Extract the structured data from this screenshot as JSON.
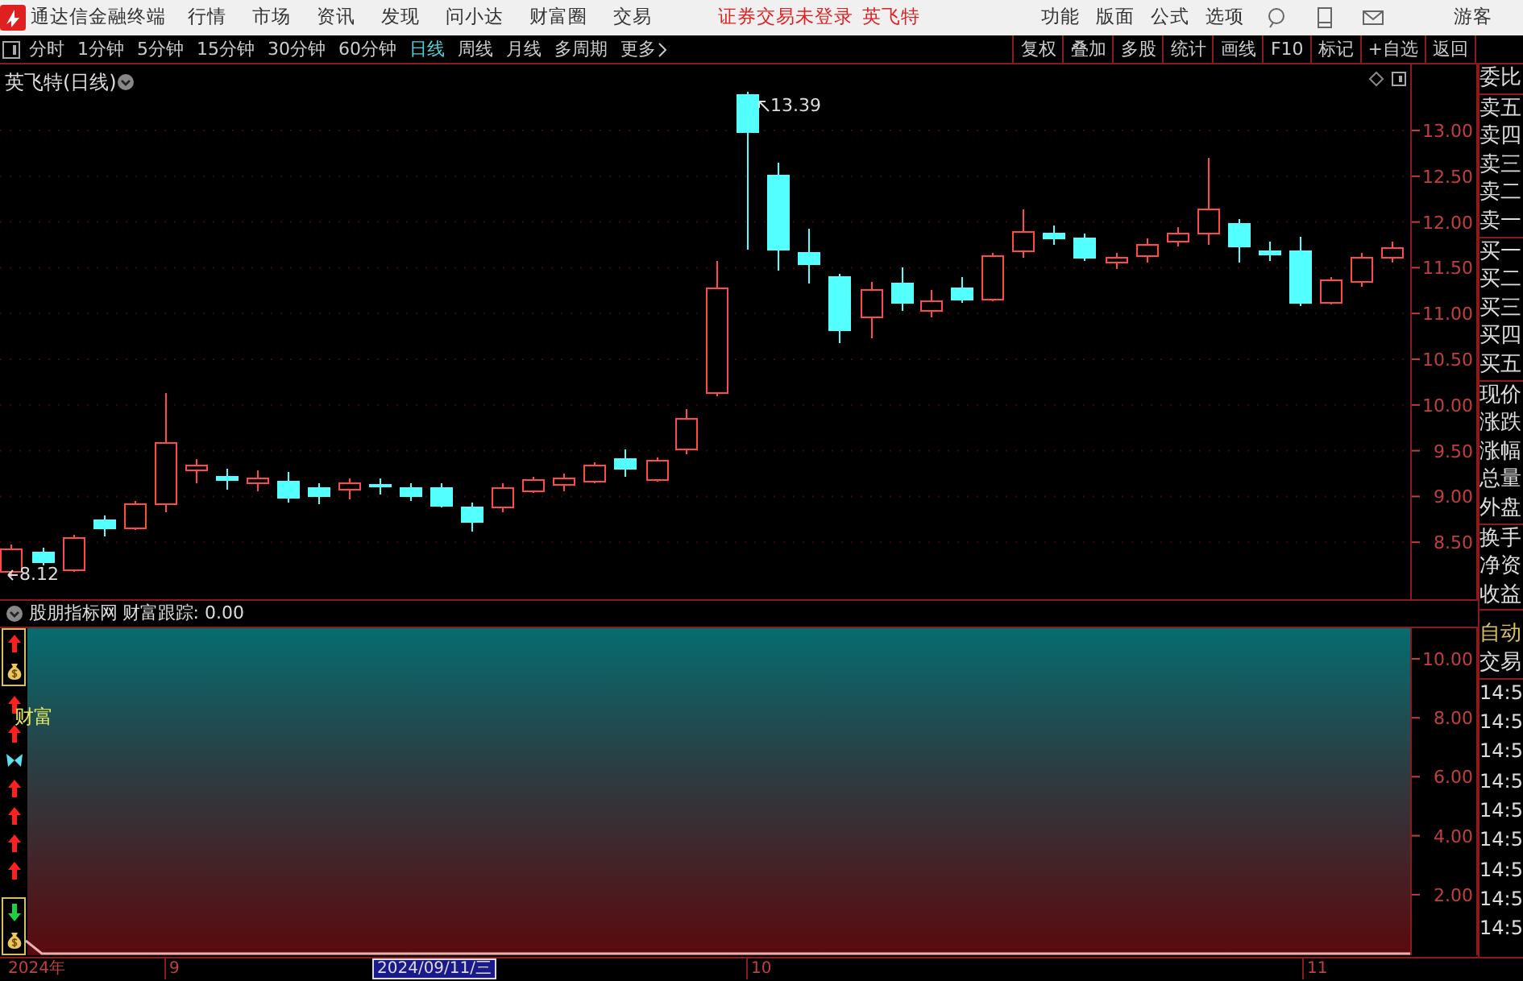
{
  "title_bar": {
    "app_title": "通达信金融终端",
    "menus": [
      "行情",
      "市场",
      "资讯",
      "发现",
      "问小达",
      "财富圈",
      "交易"
    ],
    "notice": "证券交易未登录",
    "stock": "英飞特",
    "tools": [
      "功能",
      "版面",
      "公式",
      "选项"
    ],
    "user": "游客"
  },
  "period_bar": {
    "periods": [
      {
        "label": "分时",
        "selected": false
      },
      {
        "label": "1分钟",
        "selected": false
      },
      {
        "label": "5分钟",
        "selected": false
      },
      {
        "label": "15分钟",
        "selected": false
      },
      {
        "label": "30分钟",
        "selected": false
      },
      {
        "label": "60分钟",
        "selected": false
      },
      {
        "label": "日线",
        "selected": true
      },
      {
        "label": "周线",
        "selected": false
      },
      {
        "label": "月线",
        "selected": false
      },
      {
        "label": "多周期",
        "selected": false
      }
    ],
    "more": "更多",
    "actions": [
      "复权",
      "叠加",
      "多股",
      "统计",
      "画线",
      "F10",
      "标记",
      "+自选",
      "返回"
    ]
  },
  "main_chart": {
    "caption": "英飞特(日线)",
    "high_label": "13.39",
    "low_label": "8.12",
    "yticks": [
      "13.00",
      "12.50",
      "12.00",
      "11.50",
      "11.00",
      "10.50",
      "10.00",
      "9.50",
      "9.00",
      "8.50"
    ]
  },
  "indicator": {
    "source": "股朋指标网",
    "reading": "财富跟踪: 0.00",
    "signal_text": "财富",
    "yticks": [
      "10.00",
      "8.00",
      "6.00",
      "4.00",
      "2.00"
    ]
  },
  "quote_panel": {
    "groups": [
      [
        "委比"
      ],
      [
        "卖五",
        "卖四",
        "卖三",
        "卖二",
        "卖一"
      ],
      [
        "买一",
        "买二",
        "买三",
        "买四",
        "买五"
      ],
      [
        "现价",
        "涨跌",
        "涨幅",
        "总量",
        "外盘"
      ],
      [
        "换手",
        "净资",
        "收益"
      ]
    ]
  },
  "trade_panel": {
    "header": "自动",
    "title": "交易",
    "times": [
      "14:5",
      "14:5",
      "14:5",
      "14:5",
      "14:5",
      "14:5",
      "14:5",
      "14:5",
      "14:5"
    ]
  },
  "x_axis": [
    {
      "label": "2024年",
      "highlighted": false
    },
    {
      "label": "9",
      "highlighted": false
    },
    {
      "label": "2024/09/11/三",
      "highlighted": true
    },
    {
      "label": "10",
      "highlighted": false
    },
    {
      "label": "11",
      "highlighted": false
    }
  ]
}
